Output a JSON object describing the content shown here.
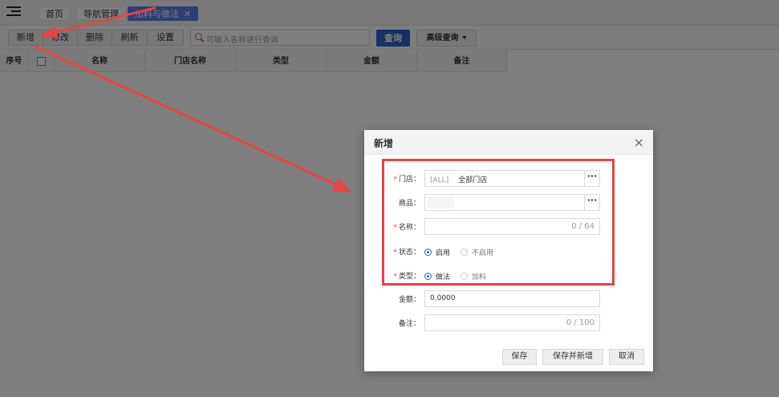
{
  "tabbar": {
    "tabs": [
      {
        "label": "首页"
      },
      {
        "label": "导航管理"
      },
      {
        "label": "加料与做法",
        "close": "✕"
      }
    ]
  },
  "toolbar": {
    "add": "新增",
    "edit": "修改",
    "delete": "删除",
    "refresh": "刷新",
    "settings": "设置",
    "search_placeholder": "可输入名称进行查询",
    "query": "查询",
    "advanced": "高级查询"
  },
  "grid": {
    "columns": [
      "序号",
      "名称",
      "门店名称",
      "类型",
      "金额",
      "备注"
    ]
  },
  "modal": {
    "title": "新增",
    "close": "×",
    "store_label": "门店",
    "store_prefix": "[ALL]",
    "store_value": "全部门店",
    "dots": "···",
    "goods_label": "商品",
    "name_label": "名称",
    "name_counter": "0 / 64",
    "status_label": "状态",
    "status_options": [
      "启用",
      "不启用"
    ],
    "type_label": "类型",
    "type_options": [
      "做法",
      "加料"
    ],
    "amount_label": "金额",
    "amount_value": "0.0000",
    "remark_label": "备注",
    "remark_counter": "0 / 100",
    "colon": "：",
    "req_mark": "*",
    "buttons": {
      "save": "保存",
      "save_new": "保存并新增",
      "cancel": "取消"
    }
  },
  "colors": {
    "accent": "#2d63c8",
    "tab_active": "#5b7de8",
    "annotation": "#e94345"
  },
  "icons": [
    "menu-toggle-icon",
    "search-icon",
    "close-icon",
    "chevron-down-icon"
  ]
}
